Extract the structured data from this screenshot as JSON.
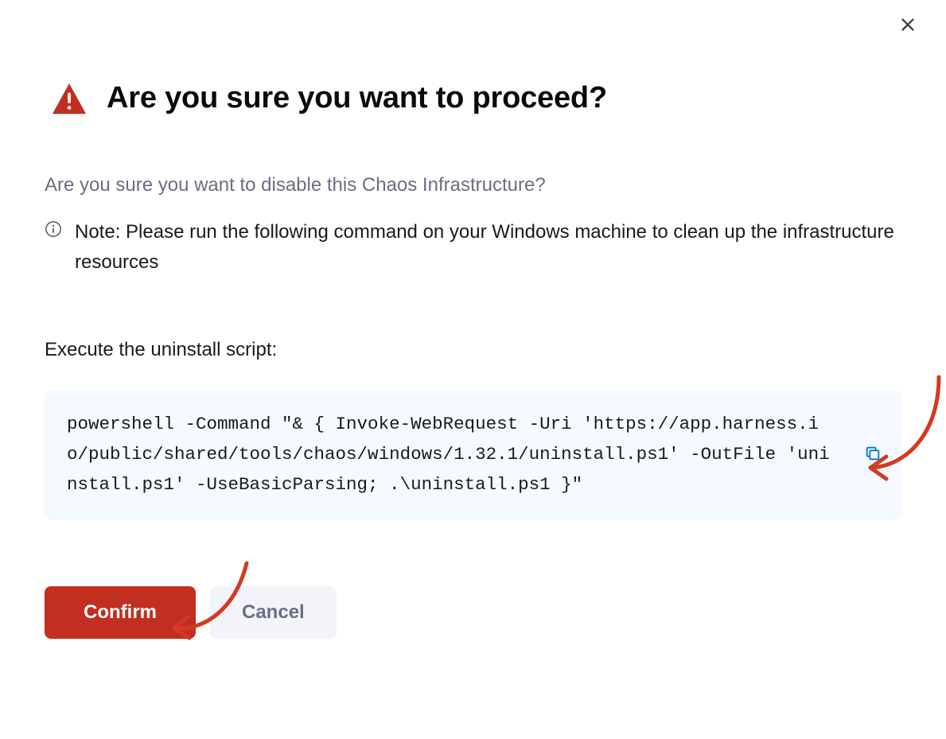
{
  "header": {
    "title": "Are you sure you want to proceed?"
  },
  "subtitle": "Are you sure you want to disable this Chaos Infrastructure?",
  "note": "Note: Please run the following command on your Windows machine to clean up the infrastructure resources",
  "script_label": "Execute the uninstall script:",
  "command": "powershell -Command \"& { Invoke-WebRequest -Uri 'https://app.harness.io/public/shared/tools/chaos/windows/1.32.1/uninstall.ps1' -OutFile 'uninstall.ps1' -UseBasicParsing; .\\uninstall.ps1 }\"",
  "actions": {
    "confirm_label": "Confirm",
    "cancel_label": "Cancel"
  },
  "colors": {
    "danger": "#c22e20",
    "muted": "#6b6d85",
    "code_bg": "#f4faff",
    "accent": "#0278d5",
    "annotation": "#d13b22"
  }
}
